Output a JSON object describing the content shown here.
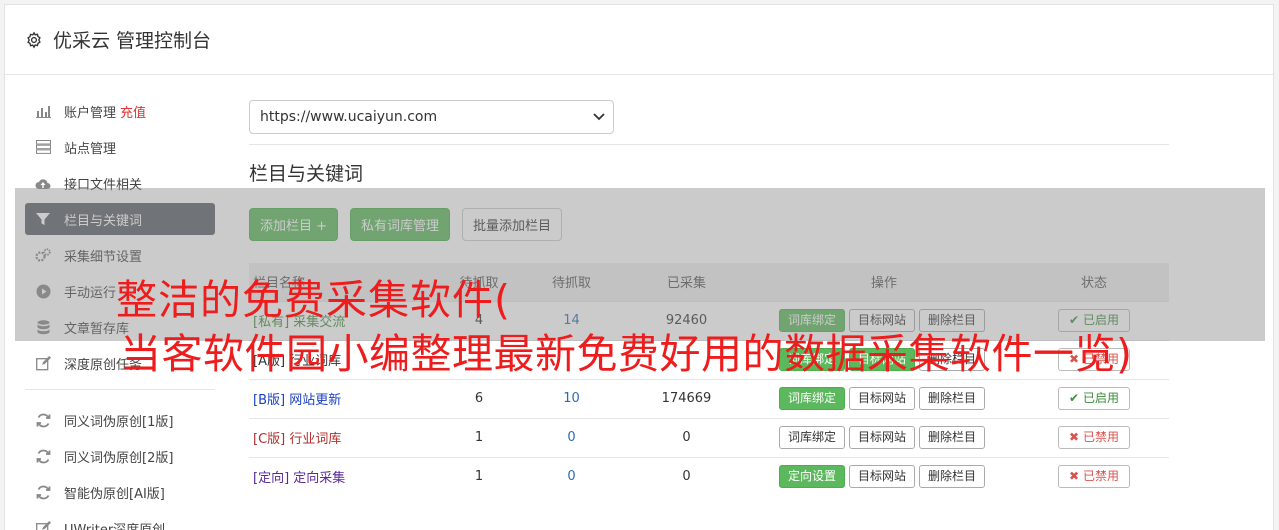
{
  "header": {
    "title": "优采云 管理控制台",
    "icon": "gear-icon"
  },
  "sidebar": {
    "items": [
      {
        "label": "账户管理",
        "extra": "充值",
        "icon": "bar-chart-icon"
      },
      {
        "label": "站点管理",
        "icon": "server-icon"
      },
      {
        "label": "接口文件相关",
        "icon": "cloud-upload-icon"
      },
      {
        "label": "栏目与关键词",
        "icon": "filter-icon",
        "active": true
      },
      {
        "label": "采集细节设置",
        "icon": "cogs-icon"
      },
      {
        "label": "手动运行",
        "icon": "play-circle-icon"
      },
      {
        "label": "文章暂存库",
        "icon": "database-icon"
      },
      {
        "label": "深度原创任务",
        "icon": "edit-icon"
      }
    ],
    "items2": [
      {
        "label": "同义词伪原创[1版]",
        "icon": "refresh-icon"
      },
      {
        "label": "同义词伪原创[2版]",
        "icon": "refresh-icon"
      },
      {
        "label": "智能伪原创[AI版]",
        "icon": "refresh-icon"
      },
      {
        "label": "UWriter深度原创",
        "icon": "edit-icon"
      }
    ]
  },
  "main": {
    "site_select": {
      "value": "https://www.ucaiyun.com"
    },
    "section_title": "栏目与关键词",
    "buttons": {
      "add": "添加栏目 +",
      "private": "私有词库管理",
      "batch": "批量添加栏目"
    },
    "table": {
      "headers": [
        "栏目名称",
        "待抓取",
        "待抓取",
        "已采集",
        "操作",
        "状态"
      ],
      "rows": [
        {
          "name": "[私有] 采集交流",
          "col1": "4",
          "col2": "14",
          "col3": "92460",
          "b1": "词库绑定",
          "b2": "目标网站",
          "b3": "删除栏目",
          "status": "已启用"
        },
        {
          "name": "[A版] 行业词库",
          "col1": "",
          "col2": "",
          "col3": "",
          "b1": "词库绑定",
          "b2": "目标网站",
          "b3": "删除栏目",
          "status": "已禁用"
        },
        {
          "name": "[B版] 网站更新",
          "col1": "6",
          "col2": "10",
          "col3": "174669",
          "b1": "词库绑定",
          "b2": "目标网站",
          "b3": "删除栏目",
          "status": "已启用"
        },
        {
          "name": "[C版] 行业词库",
          "col1": "1",
          "col2": "0",
          "col3": "0",
          "b1": "词库绑定",
          "b2": "目标网站",
          "b3": "删除栏目",
          "status": "已禁用"
        },
        {
          "name": "[定向] 定向采集",
          "col1": "1",
          "col2": "0",
          "col3": "0",
          "b1": "定向设置",
          "b2": "目标网站",
          "b3": "删除栏目",
          "status": "已禁用"
        }
      ]
    }
  },
  "overlay": {
    "line1": "整洁的免费采集软件(",
    "line2": "当客软件园小编整理最新免费好用的数据采集软件一览)"
  },
  "colors": {
    "accent_green": "#5cb85c",
    "active_sidebar": "#5a6268",
    "headline_red": "#ee1c1c"
  }
}
